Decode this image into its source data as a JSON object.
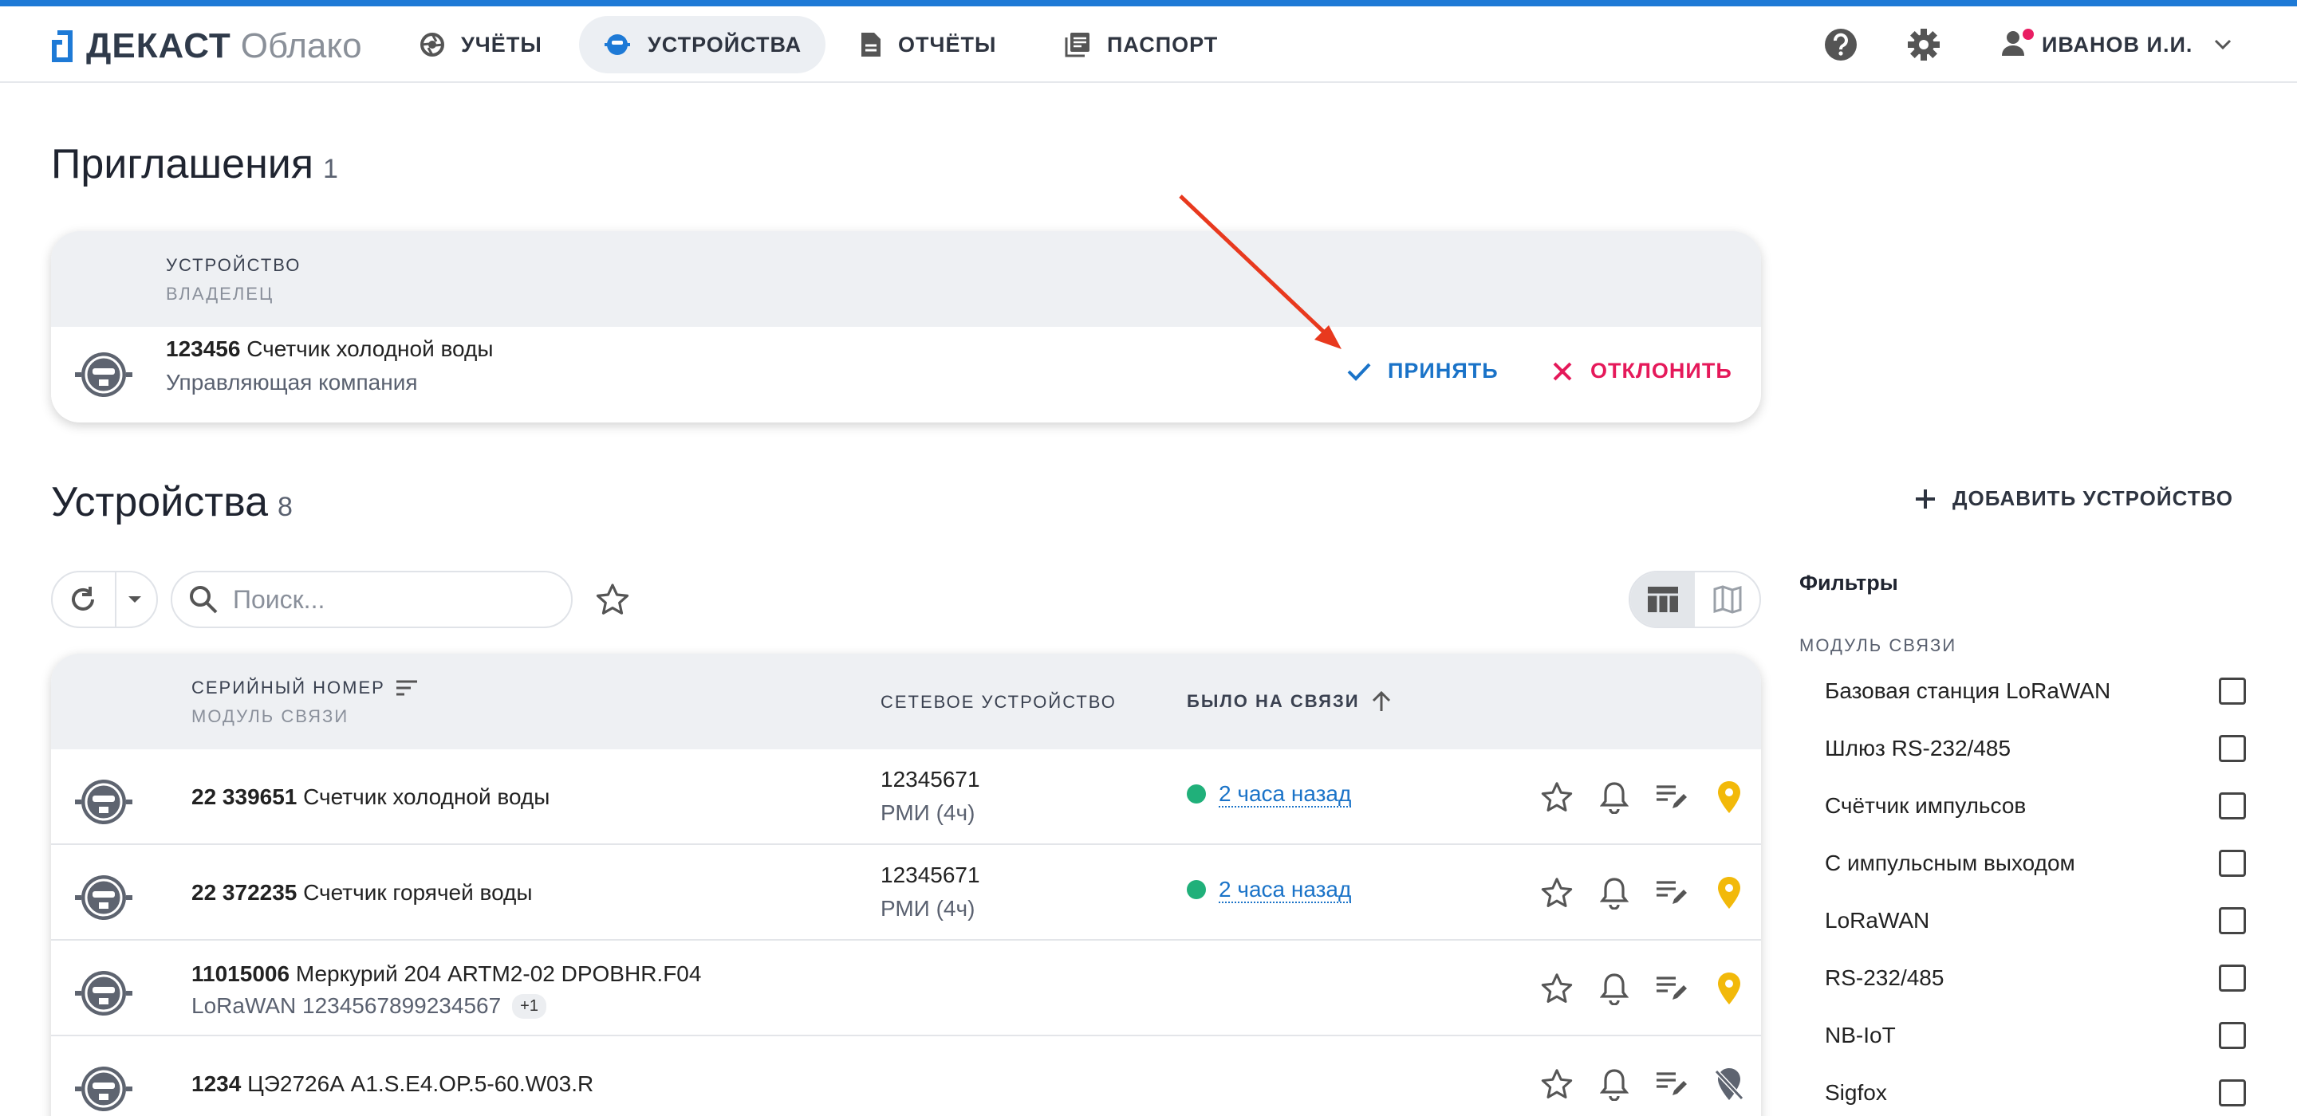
{
  "brand": {
    "name": "ДЕКАСТ",
    "sub": "Облако"
  },
  "nav": {
    "items": [
      {
        "label": "УЧЁТЫ",
        "icon": "aperture-icon"
      },
      {
        "label": "УСТРОЙСТВА",
        "icon": "meter-icon"
      },
      {
        "label": "ОТЧЁТЫ",
        "icon": "document-icon"
      },
      {
        "label": "ПАСПОРТ",
        "icon": "library-icon"
      }
    ],
    "active": "УСТРОЙСТВА",
    "user": "ИВАНОВ И.И."
  },
  "invitations": {
    "title": "Приглашения",
    "count": "1",
    "col_device": "УСТРОЙСТВО",
    "col_owner": "ВЛАДЕЛЕЦ",
    "rows": [
      {
        "serial": "123456",
        "name": "Счетчик холодной воды",
        "owner": "Управляющая компания"
      }
    ],
    "accept_label": "ПРИНЯТЬ",
    "reject_label": "ОТКЛОНИТЬ"
  },
  "devices": {
    "title": "Устройства",
    "count": "8",
    "add_label": "ДОБАВИТЬ УСТРОЙСТВО",
    "search_placeholder": "Поиск...",
    "columns": {
      "serial": "СЕРИЙНЫЙ НОМЕР",
      "module": "МОДУЛЬ СВЯЗИ",
      "network": "СЕТЕВОЕ УСТРОЙСТВО",
      "last_seen": "БЫЛО НА СВЯЗИ"
    },
    "rows": [
      {
        "serial": "22 339651",
        "name": "Счетчик холодной воды",
        "sub": "",
        "extra": "",
        "net1": "12345671",
        "net2": "РМИ (4ч)",
        "seen": "2 часа назад",
        "pin": "pin-yellow"
      },
      {
        "serial": "22 372235",
        "name": "Счетчик горячей воды",
        "sub": "",
        "extra": "",
        "net1": "12345671",
        "net2": "РМИ (4ч)",
        "seen": "2 часа назад",
        "pin": "pin-yellow"
      },
      {
        "serial": "11015006",
        "name": "Меркурий 204 ARTM2-02 DPOBHR.F04",
        "sub": "LoRaWAN 1234567899234567",
        "extra": "+1",
        "net1": "",
        "net2": "",
        "seen": "",
        "pin": "pin-yellow"
      },
      {
        "serial": "1234",
        "name": "ЦЭ2726А A1.S.E4.OP.5-60.W03.R",
        "sub": "",
        "extra": "",
        "net1": "",
        "net2": "",
        "seen": "",
        "pin": "pin-off"
      }
    ]
  },
  "filters": {
    "title": "Фильтры",
    "group": "МОДУЛЬ СВЯЗИ",
    "items": [
      "Базовая станция LoRaWAN",
      "Шлюз RS-232/485",
      "Счётчик импульсов",
      "С импульсным выходом",
      "LoRaWAN",
      "RS-232/485",
      "NB-IoT",
      "Sigfox"
    ]
  },
  "colors": {
    "accent": "#1a73c8",
    "reject": "#e5195a",
    "online": "#20b07a",
    "pin": "#f2b90a",
    "annotation_arrow": "#e8391e"
  }
}
